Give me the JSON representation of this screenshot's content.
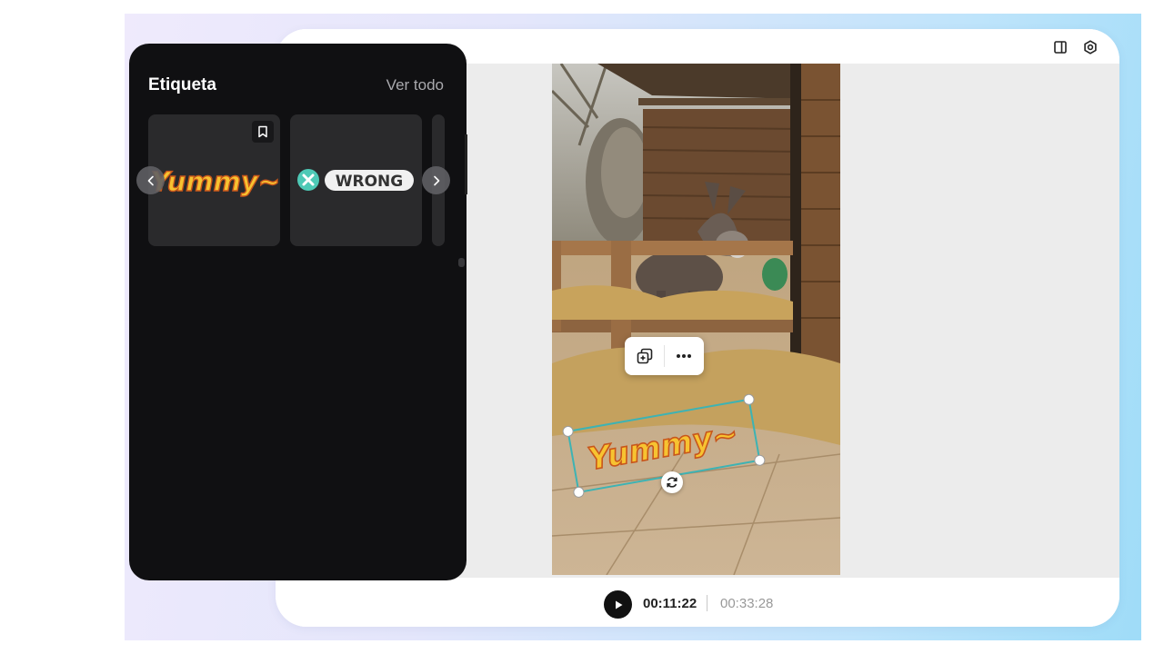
{
  "colors": {
    "panel_bg": "#101012",
    "card_bg": "#2a2a2c",
    "selection_accent": "#3db3b4",
    "sticker_fill": "#f7c331",
    "sticker_outline": "#c8561b"
  },
  "editor": {
    "header_icons": [
      "layout-panel-icon",
      "settings-gear-icon"
    ],
    "playback": {
      "current_time": "00:11:22",
      "total_time": "00:33:28"
    },
    "canvas_sticker": {
      "text": "Yummy~"
    },
    "floating_toolbar": {
      "icons": [
        "duplicate-icon",
        "more-options-icon"
      ]
    }
  },
  "sticker_panel": {
    "title": "Etiqueta",
    "view_all_label": "Ver todo",
    "cards": [
      {
        "text": "Yummy~",
        "icon": "bookmark-icon"
      },
      {
        "text": "WRONG",
        "icon": "x-circle-icon"
      }
    ]
  }
}
